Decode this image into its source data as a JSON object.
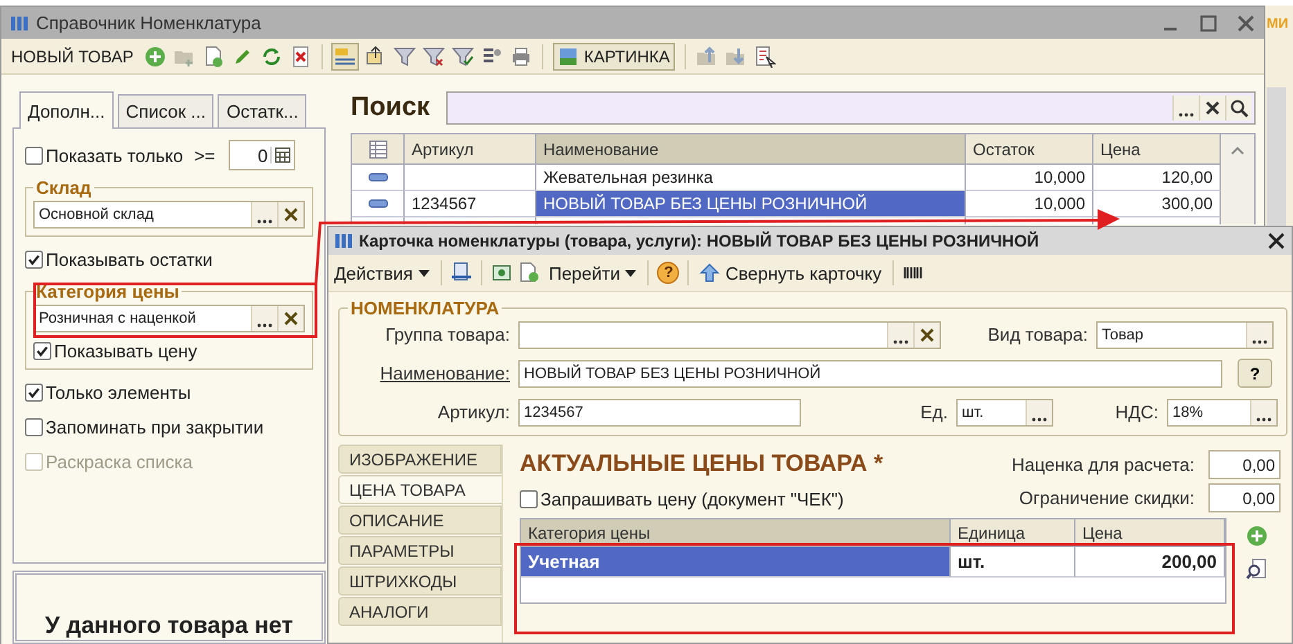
{
  "main_window": {
    "title": "Справочник Номенклатура",
    "toolbar": {
      "new_button": "НОВЫЙ ТОВАР",
      "picture_button": "КАРТИНКА"
    },
    "tabs": [
      {
        "label": "Дополн...",
        "selected": true
      },
      {
        "label": "Список ...",
        "selected": false
      },
      {
        "label": "Остатк...",
        "selected": false
      }
    ],
    "filters": {
      "show_only": {
        "label": "Показать только",
        "operator": ">=",
        "checked": false,
        "value": "0"
      },
      "warehouse": {
        "legend": "Склад",
        "value": "Основной склад"
      },
      "show_stock": {
        "label": "Показывать остатки",
        "checked": true
      },
      "price_category": {
        "legend": "Категория цены",
        "value": "Розничная с наценкой"
      },
      "show_price": {
        "label": "Показывать цену",
        "checked": true
      },
      "options": [
        {
          "label": "Только элементы",
          "checked": true,
          "disabled": false
        },
        {
          "label": "Запоминать при закрытии",
          "checked": false,
          "disabled": false
        },
        {
          "label": "Раскраска списка",
          "checked": false,
          "disabled": true
        }
      ]
    },
    "notice": "У данного товара нет",
    "search": {
      "label": "Поиск"
    },
    "table": {
      "columns": [
        "Артикул",
        "Наименование",
        "Остаток",
        "Цена"
      ],
      "rows": [
        {
          "name": "Жевательная резинка",
          "stock": "10,000",
          "price": "120,00",
          "selected": false
        },
        {
          "article": "1234567",
          "name": "НОВЫЙ ТОВАР БЕЗ ЦЕНЫ РОЗНИЧНОЙ",
          "stock": "10,000",
          "price": "300,00",
          "selected": true
        }
      ]
    }
  },
  "background_fragment": "МИ",
  "card_window": {
    "title": "Карточка номенклатуры (товара, услуги): НОВЫЙ ТОВАР БЕЗ ЦЕНЫ РОЗНИЧНОЙ",
    "toolbar": {
      "actions": "Действия",
      "goto": "Перейти",
      "help": "?",
      "collapse": "Свернуть карточку"
    },
    "section": "НОМЕНКЛАТУРА",
    "fields": {
      "group": {
        "label": "Группа товара:"
      },
      "kind": {
        "label": "Вид товара:",
        "value": "Товар"
      },
      "name": {
        "label": "Наименование:",
        "value": "НОВЫЙ ТОВАР БЕЗ ЦЕНЫ РОЗНИЧНОЙ"
      },
      "help_button": "?",
      "article": {
        "label": "Артикул:",
        "value": "1234567"
      },
      "unit": {
        "label": "Ед.",
        "value": "шт."
      },
      "vat": {
        "label": "НДС:",
        "value": "18%"
      }
    },
    "side_tabs": [
      {
        "label": "ИЗОБРАЖЕНИЕ",
        "selected": false
      },
      {
        "label": "ЦЕНА ТОВАРА",
        "selected": true
      },
      {
        "label": "ОПИСАНИЕ",
        "selected": false
      },
      {
        "label": "ПАРАМЕТРЫ",
        "selected": false
      },
      {
        "label": "ШТРИХКОДЫ",
        "selected": false
      },
      {
        "label": "АНАЛОГИ",
        "selected": false
      }
    ],
    "prices": {
      "heading": "АКТУАЛЬНЫЕ ЦЕНЫ ТОВАРА *",
      "ask_price": {
        "label": "Запрашивать цену (документ \"ЧЕК\")",
        "checked": false
      },
      "markup": {
        "label": "Наценка для расчета:",
        "value": "0,00"
      },
      "discount_limit": {
        "label": "Ограничение скидки:",
        "value": "0,00"
      },
      "table": {
        "columns": [
          "Категория цены",
          "Единица",
          "Цена"
        ],
        "rows": [
          {
            "category": "Учетная",
            "unit": "шт.",
            "price": "200,00",
            "selected": true
          }
        ]
      }
    }
  }
}
